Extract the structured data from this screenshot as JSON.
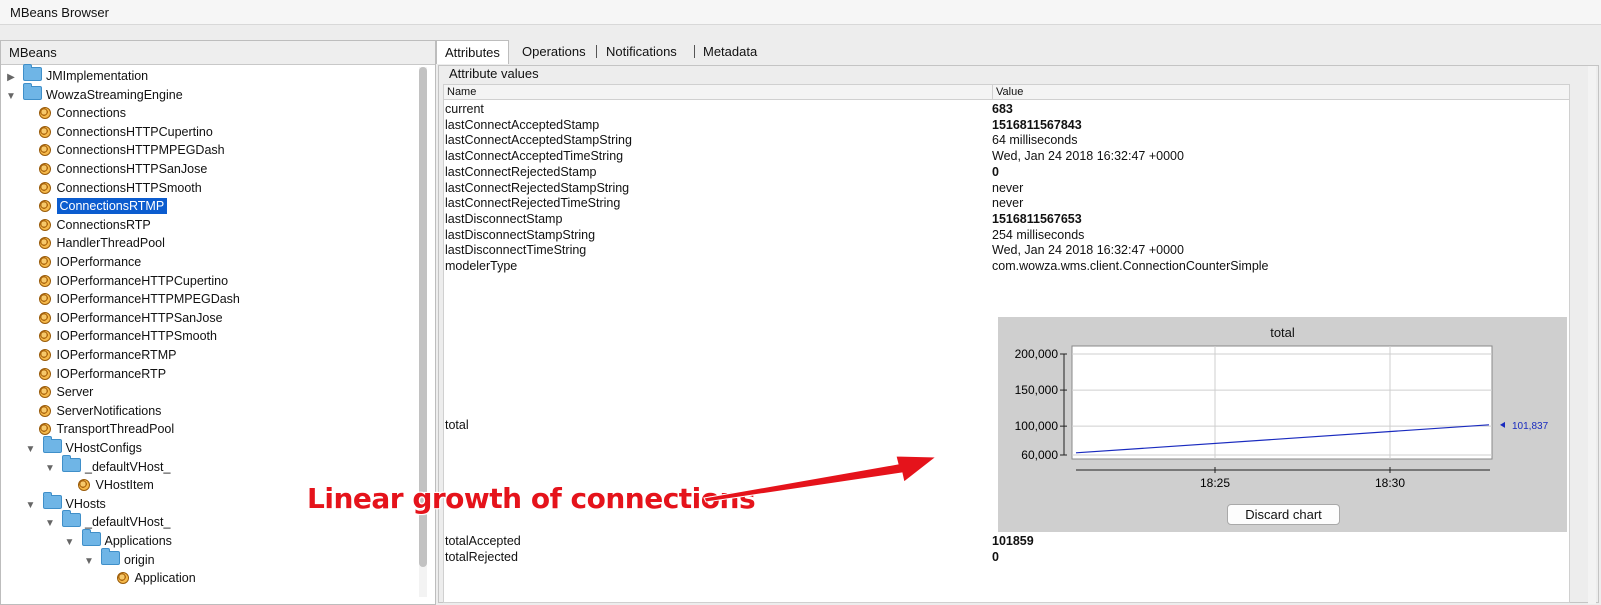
{
  "window": {
    "title": "MBeans Browser"
  },
  "left_panel": {
    "header": "MBeans",
    "tree": [
      {
        "label": "JMImplementation",
        "type": "folder",
        "state": "collapsed"
      },
      {
        "label": "WowzaStreamingEngine",
        "type": "folder",
        "state": "expanded"
      },
      {
        "label": "Connections",
        "type": "bean"
      },
      {
        "label": "ConnectionsHTTPCupertino",
        "type": "bean"
      },
      {
        "label": "ConnectionsHTTPMPEGDash",
        "type": "bean"
      },
      {
        "label": "ConnectionsHTTPSanJose",
        "type": "bean"
      },
      {
        "label": "ConnectionsHTTPSmooth",
        "type": "bean"
      },
      {
        "label": "ConnectionsRTMP",
        "type": "bean",
        "selected": true
      },
      {
        "label": "ConnectionsRTP",
        "type": "bean"
      },
      {
        "label": "HandlerThreadPool",
        "type": "bean"
      },
      {
        "label": "IOPerformance",
        "type": "bean"
      },
      {
        "label": "IOPerformanceHTTPCupertino",
        "type": "bean"
      },
      {
        "label": "IOPerformanceHTTPMPEGDash",
        "type": "bean"
      },
      {
        "label": "IOPerformanceHTTPSanJose",
        "type": "bean"
      },
      {
        "label": "IOPerformanceHTTPSmooth",
        "type": "bean"
      },
      {
        "label": "IOPerformanceRTMP",
        "type": "bean"
      },
      {
        "label": "IOPerformanceRTP",
        "type": "bean"
      },
      {
        "label": "Server",
        "type": "bean"
      },
      {
        "label": "ServerNotifications",
        "type": "bean"
      },
      {
        "label": "TransportThreadPool",
        "type": "bean"
      },
      {
        "label": "VHostConfigs",
        "type": "folder",
        "state": "expanded"
      },
      {
        "label": "_defaultVHost_",
        "type": "folder",
        "state": "expanded"
      },
      {
        "label": "VHostItem",
        "type": "bean"
      },
      {
        "label": "VHosts",
        "type": "folder",
        "state": "expanded"
      },
      {
        "label": "_defaultVHost_",
        "type": "folder",
        "state": "expanded"
      },
      {
        "label": "Applications",
        "type": "folder",
        "state": "expanded"
      },
      {
        "label": "origin",
        "type": "folder",
        "state": "expanded"
      },
      {
        "label": "Application",
        "type": "bean"
      }
    ]
  },
  "tabs": [
    "Attributes",
    "Operations",
    "Notifications",
    "Metadata"
  ],
  "attributes": {
    "legend": "Attribute values",
    "columns": [
      "Name",
      "Value"
    ],
    "rows": [
      {
        "name": "current",
        "value": "683",
        "bold": true
      },
      {
        "name": "lastConnectAcceptedStamp",
        "value": "1516811567843",
        "bold": true
      },
      {
        "name": "lastConnectAcceptedStampString",
        "value": "64 milliseconds"
      },
      {
        "name": "lastConnectAcceptedTimeString",
        "value": "Wed, Jan 24 2018 16:32:47 +0000"
      },
      {
        "name": "lastConnectRejectedStamp",
        "value": "0",
        "bold": true
      },
      {
        "name": "lastConnectRejectedStampString",
        "value": "never"
      },
      {
        "name": "lastConnectRejectedTimeString",
        "value": "never"
      },
      {
        "name": "lastDisconnectStamp",
        "value": "1516811567653",
        "bold": true
      },
      {
        "name": "lastDisconnectStampString",
        "value": "254 milliseconds"
      },
      {
        "name": "lastDisconnectTimeString",
        "value": "Wed, Jan 24 2018 16:32:47 +0000"
      },
      {
        "name": "modelerType",
        "value": "com.wowza.wms.client.ConnectionCounterSimple"
      }
    ],
    "total_row": {
      "name": "total"
    },
    "after_rows": [
      {
        "name": "totalAccepted",
        "value": "101859",
        "bold": true
      },
      {
        "name": "totalRejected",
        "value": "0",
        "bold": true
      }
    ],
    "discard_button": "Discard chart"
  },
  "chart_data": {
    "type": "line",
    "title": "total",
    "y_ticks": [
      "200,000",
      "150,000",
      "100,000",
      "60,000"
    ],
    "x_ticks": [
      "18:25",
      "18:30"
    ],
    "ylim": [
      60000,
      200000
    ],
    "series": [
      {
        "color": "#1a2bbf",
        "x": [
          "18:21",
          "18:32"
        ],
        "y": [
          63000,
          101837
        ]
      }
    ],
    "last_value_label": "101,837",
    "grid": true
  },
  "annotation": {
    "text": "Linear growth of connections",
    "color": "#e5131b"
  }
}
